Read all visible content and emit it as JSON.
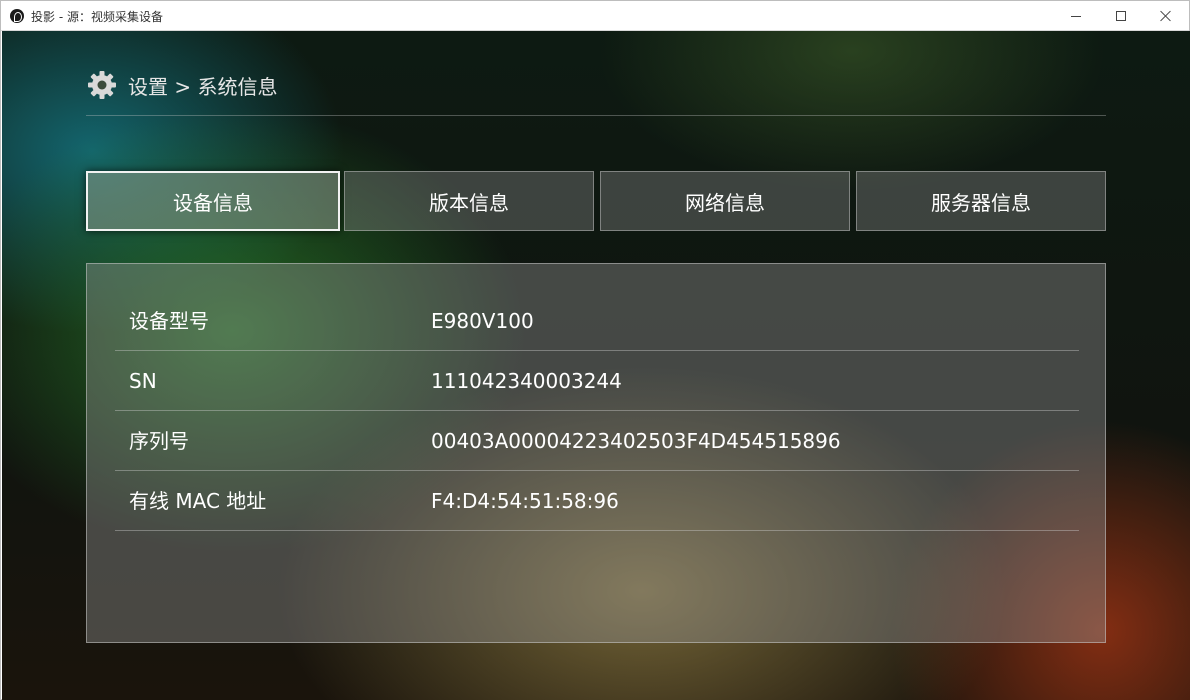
{
  "window": {
    "title": "投影 - 源：视频采集设备",
    "icon": "obs-app-icon",
    "controls": {
      "minimize": "minimize-icon",
      "maximize": "maximize-icon",
      "close": "close-icon"
    }
  },
  "header": {
    "icon": "gear-icon",
    "breadcrumb": "设置 > 系统信息"
  },
  "tabs": [
    {
      "label": "设备信息",
      "active": true
    },
    {
      "label": "版本信息",
      "active": false
    },
    {
      "label": "网络信息",
      "active": false
    },
    {
      "label": "服务器信息",
      "active": false
    }
  ],
  "device_info": {
    "rows": [
      {
        "label": "设备型号",
        "value": "E980V100"
      },
      {
        "label": "SN",
        "value": "111042340003244"
      },
      {
        "label": "序列号",
        "value": "00403A00004223402503F4D454515896"
      },
      {
        "label": "有线 MAC 地址",
        "value": "F4:D4:54:51:58:96"
      }
    ]
  },
  "colors": {
    "text": "#ffffff",
    "active_tab_border": "#f2f2f2"
  }
}
